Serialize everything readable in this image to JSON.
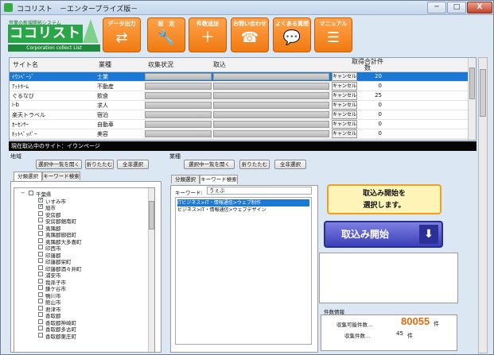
{
  "window": {
    "title": "ココリスト　－エンタープライズ版－",
    "min": "─",
    "max": "□",
    "close": "X"
  },
  "logo": {
    "sub": "営業の新規開拓システム",
    "main": "ココリスト",
    "en": "Corporation collect List"
  },
  "toolbar": [
    {
      "label": "データ出力",
      "icon": "⇄"
    },
    {
      "label": "設　定",
      "icon": "🔧"
    },
    {
      "label": "件数追加",
      "icon": "＋"
    },
    {
      "label": "お問い合わせ",
      "icon": "☎"
    },
    {
      "label": "よくある質問",
      "icon": "💬"
    },
    {
      "label": "マニュアル",
      "icon": "☰"
    }
  ],
  "grid": {
    "headers": {
      "name": "サイト名",
      "industry": "業種",
      "status": "収集状況",
      "retrieve": "取込",
      "count": "取得合計件数"
    },
    "rows": [
      {
        "name": "ｲｳﾝﾍﾟｰｼﾞ",
        "industry": "士業",
        "cancel": "キャンセル",
        "count": "20",
        "selected": true
      },
      {
        "name": "ｱｯﾄﾎｰﾑ",
        "industry": "不動産",
        "cancel": "キャンセル",
        "count": "0"
      },
      {
        "name": "ぐるなび",
        "industry": "飲食",
        "cancel": "キャンセル",
        "count": "25"
      },
      {
        "name": "i-b",
        "industry": "求人",
        "cancel": "キャンセル",
        "count": "0"
      },
      {
        "name": "楽天トラベル",
        "industry": "宿泊",
        "cancel": "キャンセル",
        "count": "0"
      },
      {
        "name": "ｶｰｾﾝｻｰ",
        "industry": "自動車",
        "cancel": "キャンセル",
        "count": "0"
      },
      {
        "name": "ﾎｯﾄﾍﾟｯﾊﾟｰ",
        "industry": "美容",
        "cancel": "キャンセル",
        "count": "0"
      }
    ]
  },
  "status_strip": "現在取込中のサイト：イウンページ",
  "region": {
    "label": "地域",
    "buttons": [
      "選択中一覧を開く",
      "折りたたむ",
      "全非選択"
    ],
    "tabs": [
      "分類選択",
      "キーワード検索"
    ],
    "tree": [
      {
        "text": "千葉県",
        "level": 0,
        "checked": false,
        "expander": "−"
      },
      {
        "text": "いすみ市",
        "level": 1,
        "checked": true
      },
      {
        "text": "旭市",
        "level": 1,
        "checked": true
      },
      {
        "text": "安房郡",
        "level": 1,
        "checked": false
      },
      {
        "text": "安房郡鋸南町",
        "level": 1,
        "checked": false
      },
      {
        "text": "夷隅郡",
        "level": 1,
        "checked": false
      },
      {
        "text": "夷隅郡御宿町",
        "level": 1,
        "checked": false
      },
      {
        "text": "夷隅郡大多喜町",
        "level": 1,
        "checked": false
      },
      {
        "text": "印西市",
        "level": 1,
        "checked": false
      },
      {
        "text": "印旛郡",
        "level": 1,
        "checked": false
      },
      {
        "text": "印旛郡栄町",
        "level": 1,
        "checked": false
      },
      {
        "text": "印旛郡酒々井町",
        "level": 1,
        "checked": false
      },
      {
        "text": "浦安市",
        "level": 1,
        "checked": false
      },
      {
        "text": "我孫子市",
        "level": 1,
        "checked": false
      },
      {
        "text": "鎌ケ谷市",
        "level": 1,
        "checked": false
      },
      {
        "text": "鴨川市",
        "level": 1,
        "checked": false
      },
      {
        "text": "館山市",
        "level": 1,
        "checked": false
      },
      {
        "text": "君津市",
        "level": 1,
        "checked": false
      },
      {
        "text": "香取郡",
        "level": 1,
        "checked": false
      },
      {
        "text": "香取郡神崎町",
        "level": 1,
        "checked": false
      },
      {
        "text": "香取郡多古町",
        "level": 1,
        "checked": false
      },
      {
        "text": "香取郡東庄町",
        "level": 1,
        "checked": false
      }
    ]
  },
  "industry": {
    "label": "業種",
    "buttons": [
      "選択中一覧を開く",
      "折りたたむ",
      "全非選択"
    ],
    "tabs": [
      "分類選択",
      "キーワード検索"
    ],
    "keyword_label": "キーワード:",
    "keyword_value": "うぇぶ",
    "results": [
      {
        "text": "ITビジネス>IT・情報通信>ウェブ制作",
        "selected": true
      },
      {
        "text": "ビジネス>IT・情報通信>ウェブデザイン",
        "selected": false
      }
    ]
  },
  "right": {
    "tooltip": "取込み開始を\n選択します。",
    "start_button": "取込み開始",
    "start_icon": "⬇",
    "info_label": "件数情報",
    "possible_label": "収集可能件数…",
    "possible_value": "80055",
    "possible_unit": "件",
    "collected_label": "収集件数…",
    "collected_value": "45",
    "collected_unit": "件"
  }
}
